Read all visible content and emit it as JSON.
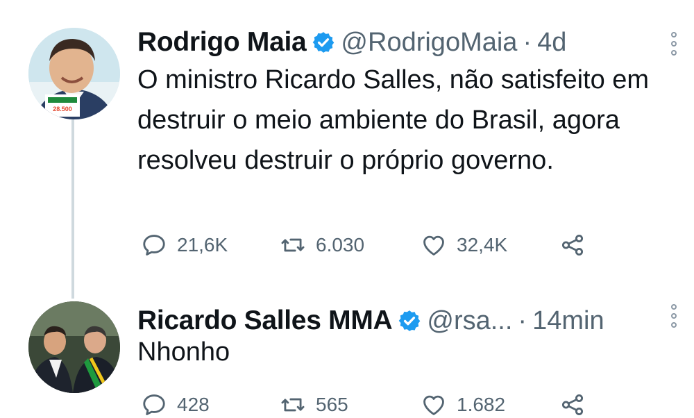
{
  "tweets": [
    {
      "name": "Rodrigo Maia",
      "handle": "@RodrigoMaia",
      "separator": "·",
      "time": "4d",
      "text": "O ministro Ricardo Salles, não satisfeito em destruir o meio ambiente do Brasil, agora resolveu destruir o próprio governo.",
      "avatar_badge": [
        "28.500"
      ],
      "replies": "21,6K",
      "retweets": "6.030",
      "likes": "32,4K"
    },
    {
      "name": "Ricardo Salles MMA",
      "handle": "@rsa...",
      "separator": "·",
      "time": "14min",
      "text": "Nhonho",
      "replies": "428",
      "retweets": "565",
      "likes": "1.682"
    }
  ],
  "colors": {
    "verified": "#1d9bf0",
    "muted": "#536471",
    "thread_line": "#cfd9de"
  },
  "icons": [
    "verified-badge-icon",
    "more-options-icon",
    "reply-icon",
    "retweet-icon",
    "like-icon",
    "share-icon"
  ]
}
